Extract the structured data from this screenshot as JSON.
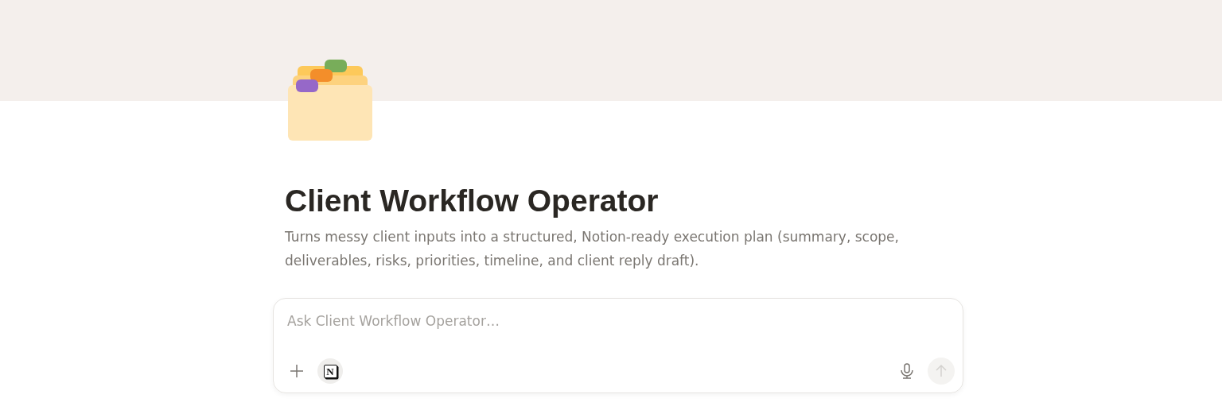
{
  "page": {
    "title": "Client Workflow Operator",
    "description": "Turns messy client inputs into a structured, Notion-ready execution plan (summary, scope, deliverables, risks, priorities, timeline, and client reply draft)."
  },
  "composer": {
    "placeholder": "Ask Client Workflow Operator…",
    "connector_label": "N",
    "send_disabled": true
  }
}
